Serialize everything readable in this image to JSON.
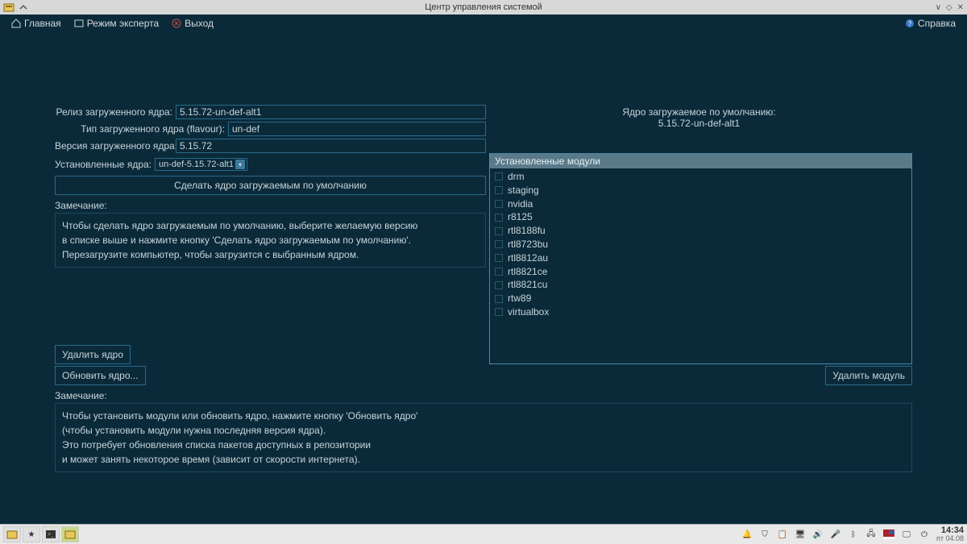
{
  "titlebar": {
    "title": "Центр управления системой"
  },
  "menubar": {
    "home": "Главная",
    "expert": "Режим эксперта",
    "exit": "Выход",
    "help": "Справка"
  },
  "form": {
    "release_label": "Релиз загруженного ядра:",
    "release_value": "5.15.72-un-def-alt1",
    "flavour_label": "Тип загруженного ядра (flavour):",
    "flavour_value": "un-def",
    "version_label": "Версия загруженного ядра:",
    "version_value": "5.15.72"
  },
  "default_kernel": {
    "label": "Ядро загружаемое по умолчанию:",
    "value": "5.15.72-un-def-alt1"
  },
  "installed": {
    "label": "Установленные ядра:",
    "selected": "un-def-5.15.72-alt1"
  },
  "buttons": {
    "make_default": "Сделать ядро загружаемым по умолчанию",
    "remove_kernel": "Удалить ядро",
    "update_kernel": "Обновить ядро...",
    "remove_module": "Удалить модуль"
  },
  "notes": {
    "label": "Замечание:",
    "note1_l1": "Чтобы сделать ядро загружаемым по умолчанию, выберите желаемую версию",
    "note1_l2": "в списке выше и нажмите кнопку 'Сделать ядро загружаемым по умолчанию'.",
    "note1_l3": "Перезагрузите компьютер, чтобы загрузится с выбранным ядром.",
    "note2_l1": "Чтобы установить модули или обновить ядро, нажмите кнопку 'Обновить ядро'",
    "note2_l2": "(чтобы установить модули нужна последняя версия ядра).",
    "note2_l3": "Это потребует обновления списка пакетов доступных в репозитории",
    "note2_l4": "и может занять некоторое время (зависит от скорости интернета)."
  },
  "modules": {
    "header": "Установленные модули",
    "items": [
      "drm",
      "staging",
      "nvidia",
      "r8125",
      "rtl8188fu",
      "rtl8723bu",
      "rtl8812au",
      "rtl8821ce",
      "rtl8821cu",
      "rtw89",
      "virtualbox"
    ]
  },
  "taskbar": {
    "time": "14:34",
    "date": "пт 04.08"
  }
}
